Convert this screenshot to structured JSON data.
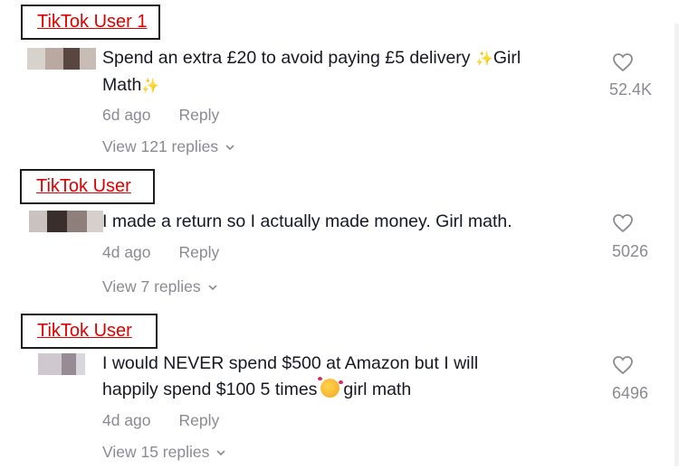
{
  "comments": [
    {
      "user": "TikTok User 1",
      "text_part1": "Spend an extra £20 to avoid paying £5 delivery ",
      "sparkle": "✨",
      "text_part2": "Girl",
      "text_line2": "Math",
      "age": "6d ago",
      "reply": "Reply",
      "view_replies": "View 121 replies",
      "likes": "52.4K"
    },
    {
      "user": "TikTok User",
      "text": "I made a return so I actually made money. Girl math.",
      "age": "4d ago",
      "reply": "Reply",
      "view_replies": "View 7 replies",
      "likes": "5026"
    },
    {
      "user": "TikTok User",
      "text_line1": "I would NEVER spend $500 at Amazon but I will",
      "text_line2_a": "happily spend $100 5 times",
      "emoji": "smiling-face-with-hearts",
      "text_line2_b": "girl math",
      "age": "4d ago",
      "reply": "Reply",
      "view_replies": "View 15 replies",
      "likes": "6496"
    }
  ],
  "icons": {
    "like": "heart-outline-icon",
    "expand": "chevron-down-icon"
  },
  "colors": {
    "username": "#e00000",
    "muted": "#8a8b91",
    "text": "#161823"
  }
}
